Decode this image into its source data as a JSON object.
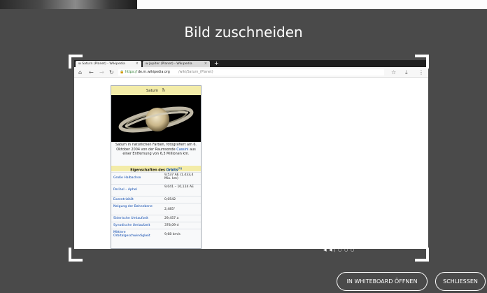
{
  "dialog": {
    "title": "Bild zuschneiden",
    "open_button_label": "IN WHITEBOARD ÖFFNEN",
    "close_button_label": "SCHLIESSEN"
  },
  "screenshot": {
    "tabs": [
      {
        "label": "w Saturn (Planet) - Wikipedia",
        "close": "×"
      },
      {
        "label": "w Jupiter (Planet) - Wikipedia",
        "close": "×"
      }
    ],
    "new_tab_symbol": "+",
    "nav_icons": [
      "home-icon",
      "back-arrow-icon",
      "forward-arrow-icon",
      "reload-icon"
    ],
    "url": {
      "scheme": "https://",
      "domain": "de.m.wikipedia.org",
      "path": "/wiki/Saturn_(Planet)"
    },
    "toolbar_icons": [
      "star-icon",
      "download-icon",
      "menu-icon"
    ],
    "infobox": {
      "title": "Saturn",
      "symbol": "♄",
      "caption": "Saturn in natürlichen Farben, fotografiert am 6. Oktober 2004 von der Raumsonde",
      "caption_link": "Cassini",
      "caption_tail": "aus einer Entfernung von 6,3 Millionen km.",
      "section_title": "Eigenschaften des",
      "section_link": "Orbits",
      "section_ref": "[1]",
      "rows": [
        {
          "key": "Große Halbachse",
          "value": "9,537 AE (1.433,4 Mio. km)"
        },
        {
          "key": "Perihel – Aphel",
          "value": "9,041 – 10,124 AE"
        },
        {
          "key": "Exzentrizität",
          "value": "0,0542"
        },
        {
          "key": "Neigung der Bahnebene",
          "value": "2,485°"
        },
        {
          "key": "Siderische Umlaufzeit",
          "value": "29,457 a"
        },
        {
          "key": "Synodische Umlaufzeit",
          "value": "378,09 d"
        },
        {
          "key": "Mittlere Orbitalgeschwindigkeit",
          "value": "9,68 km/s"
        }
      ]
    }
  },
  "pager": {
    "items": [
      "◀",
      "◀",
      "|",
      "○",
      "○",
      "○"
    ]
  },
  "colors": {
    "overlay": "#4a4a4a",
    "infobox_header": "#f3eca8",
    "link": "#0645ad",
    "secure": "#2e7d32"
  }
}
